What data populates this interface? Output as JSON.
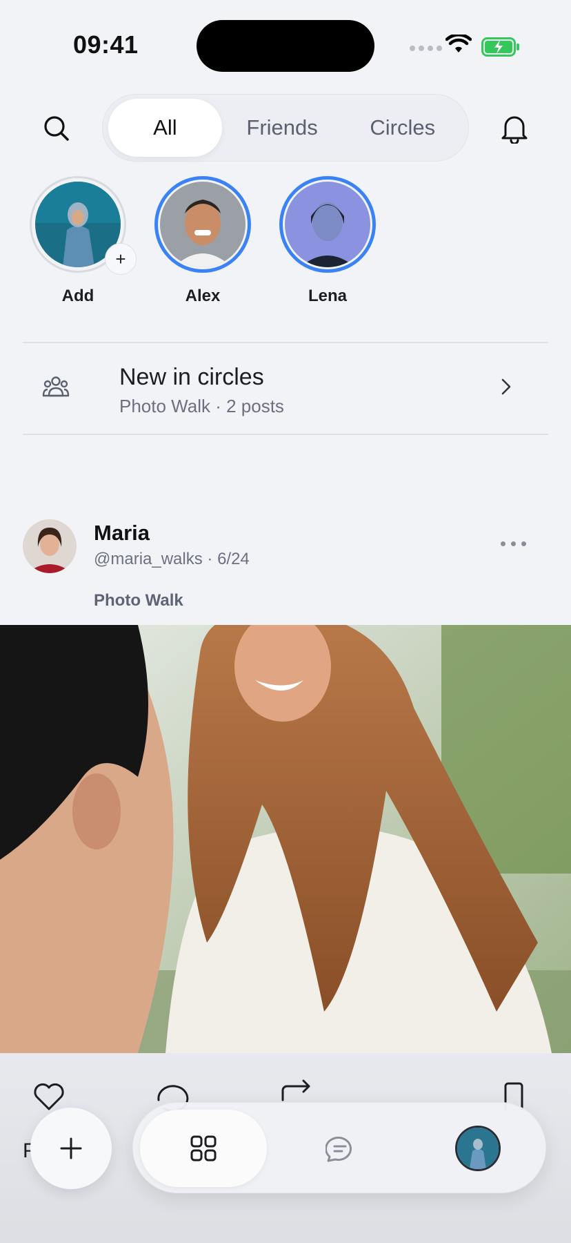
{
  "status_bar": {
    "time": "09:41"
  },
  "top_nav": {
    "tabs": [
      {
        "label": "All",
        "active": true
      },
      {
        "label": "Friends",
        "active": false
      },
      {
        "label": "Circles",
        "active": false
      }
    ],
    "search_icon": "search-icon",
    "bell_icon": "bell-icon"
  },
  "stories": [
    {
      "name": "Add",
      "ring": "none",
      "has_plus": true
    },
    {
      "name": "Alex",
      "ring": "unseen"
    },
    {
      "name": "Lena",
      "ring": "unseen"
    }
  ],
  "circles_banner": {
    "title": "New in circles",
    "subtitle": "Photo Walk · 2 posts",
    "icon": "people-group-icon"
  },
  "post": {
    "author": "Maria",
    "meta": "@maria_walks · 6/24",
    "circle_tag": "Photo Walk"
  },
  "actions_behind": {
    "partial_text": "F              oge"
  },
  "bottom_bar": {
    "fab_icon": "plus-icon",
    "tabs": [
      "grid-icon",
      "chat-bubble-icon",
      "profile-avatar"
    ]
  },
  "colors": {
    "accent": "#3b82f6",
    "background": "#f2f3f7"
  }
}
